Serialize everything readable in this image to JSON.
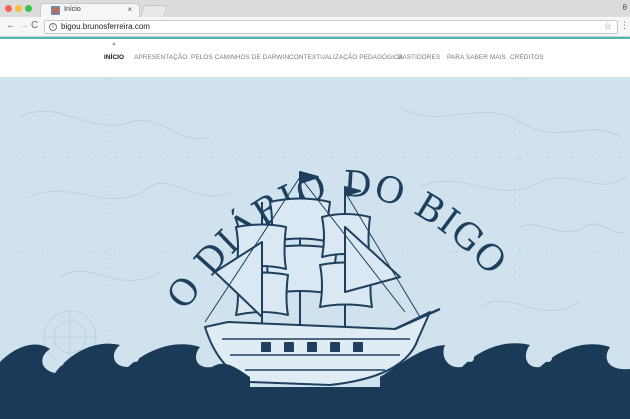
{
  "browser": {
    "tab_title": "Início",
    "tab_close": "×",
    "url": "bigou.brunosferreira.com",
    "back_glyph": "←",
    "forward_glyph": "→",
    "reload_glyph": "C",
    "info_glyph": "i",
    "star_glyph": "☆",
    "menu_glyph": "⋮",
    "profile_glyph": "θ"
  },
  "site_nav": {
    "items": [
      {
        "label": "INÍCIO",
        "active": true
      },
      {
        "label": "APRESENTAÇÃO",
        "active": false
      },
      {
        "label": "PELOS CAMINHOS DE DARWIN",
        "active": false
      },
      {
        "label": "CONTEXTUALIZAÇÃO PEDAGÓGICA",
        "active": false
      },
      {
        "label": "BASTIDORES",
        "active": false
      },
      {
        "label": "PARA SABER MAIS",
        "active": false
      },
      {
        "label": "CRÉDITOS",
        "active": false
      }
    ]
  },
  "hero": {
    "title": "O DIÁRIO DO BIGOU",
    "illustration": "sailing-ship-icon",
    "background_color": "#cfe2ee",
    "ink_color": "#1e3f5e",
    "wave_color": "#1b3a57"
  },
  "colors": {
    "accent": "#4fb6b1",
    "nav_active": "#111111",
    "nav_inactive": "#7a7a7a"
  }
}
